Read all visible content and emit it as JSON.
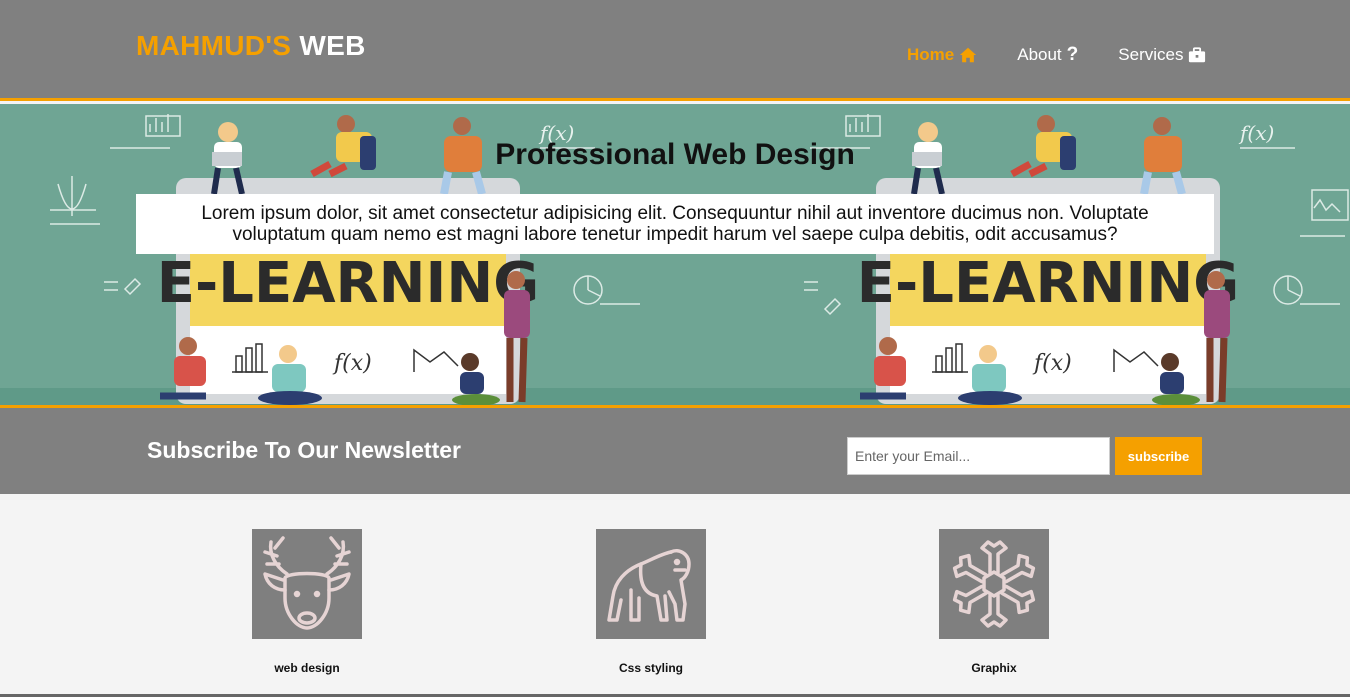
{
  "header": {
    "logo_highlight": "MAHMUD'S",
    "logo_rest": "WEB",
    "nav": [
      {
        "label": "Home",
        "icon": "home-icon",
        "active": true
      },
      {
        "label": "About",
        "icon": "question-icon",
        "active": false
      },
      {
        "label": "Services",
        "icon": "briefcase-icon",
        "active": false
      }
    ]
  },
  "hero": {
    "title": "Professional Web Design",
    "text": "Lorem ipsum dolor, sit amet consectetur adipisicing elit. Consequuntur nihil aut inventore ducimus non. Voluptate voluptatum quam nemo est magni labore tenetur impedit harum vel saepe culpa debitis, odit accusamus?",
    "illustration_text": "E-LEARNING"
  },
  "newsletter": {
    "heading": "Subscribe To Our Newsletter",
    "email_placeholder": "Enter your Email...",
    "email_value": "",
    "button_label": "subscribe"
  },
  "boxes": [
    {
      "label": "web design",
      "icon": "deer-icon"
    },
    {
      "label": "Css styling",
      "icon": "gorilla-icon"
    },
    {
      "label": "Graphix",
      "icon": "snowflake-icon"
    }
  ],
  "colors": {
    "accent": "#f5a000",
    "header_bg": "#808080",
    "hero_bg": "#6fa594",
    "tile_bg": "#7f7f7f",
    "page_bg": "#f4f4f4"
  }
}
